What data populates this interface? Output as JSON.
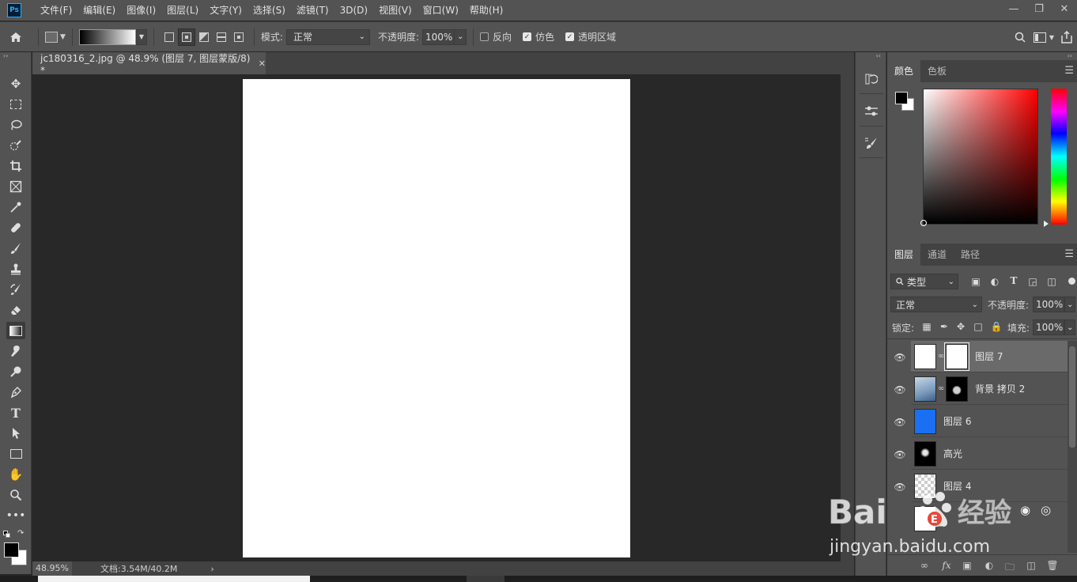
{
  "menubar": {
    "logo": "Ps",
    "items": [
      "文件(F)",
      "编辑(E)",
      "图像(I)",
      "图层(L)",
      "文字(Y)",
      "选择(S)",
      "滤镜(T)",
      "3D(D)",
      "视图(V)",
      "窗口(W)",
      "帮助(H)"
    ],
    "window_controls": [
      "minimize-icon",
      "restore-icon",
      "close-icon"
    ]
  },
  "options": {
    "mode_label": "模式:",
    "mode_value": "正常",
    "opacity_label": "不透明度:",
    "opacity_value": "100%",
    "reverse_label": "反向",
    "reverse_checked": false,
    "dither_label": "仿色",
    "dither_checked": true,
    "transparency_label": "透明区域",
    "transparency_checked": true
  },
  "document": {
    "tab_title": "jc180316_2.jpg @ 48.9% (图层 7, 图层蒙版/8) *",
    "zoom": "48.95%",
    "doc_info": "文档:3.54M/40.2M"
  },
  "color_panel": {
    "tabs": [
      "颜色",
      "色板"
    ],
    "foreground": "#000000",
    "background": "#ffffff",
    "hue_color": "#ff0000"
  },
  "layers_panel": {
    "tabs": [
      "图层",
      "通道",
      "路径"
    ],
    "filter_label": "类型",
    "blend_mode": "正常",
    "opacity_label": "不透明度:",
    "opacity_value": "100%",
    "lock_label": "锁定:",
    "fill_label": "填充:",
    "fill_value": "100%",
    "layers": [
      {
        "name": "图层 7",
        "selected": true,
        "thumb": "#ffffff",
        "mask": "#ffffff"
      },
      {
        "name": "背景 拷贝 2",
        "selected": false,
        "thumb": "#8aa6c4",
        "mask": "#000000"
      },
      {
        "name": "图层 6",
        "selected": false,
        "thumb": "#1a6ff2"
      },
      {
        "name": "高光",
        "selected": false,
        "thumb": "#000000"
      },
      {
        "name": "图层 4",
        "selected": false,
        "thumb": "checker"
      }
    ]
  },
  "watermark": {
    "brand": "Baidu",
    "cn": "经验",
    "url": "jingyan.baidu.com"
  }
}
